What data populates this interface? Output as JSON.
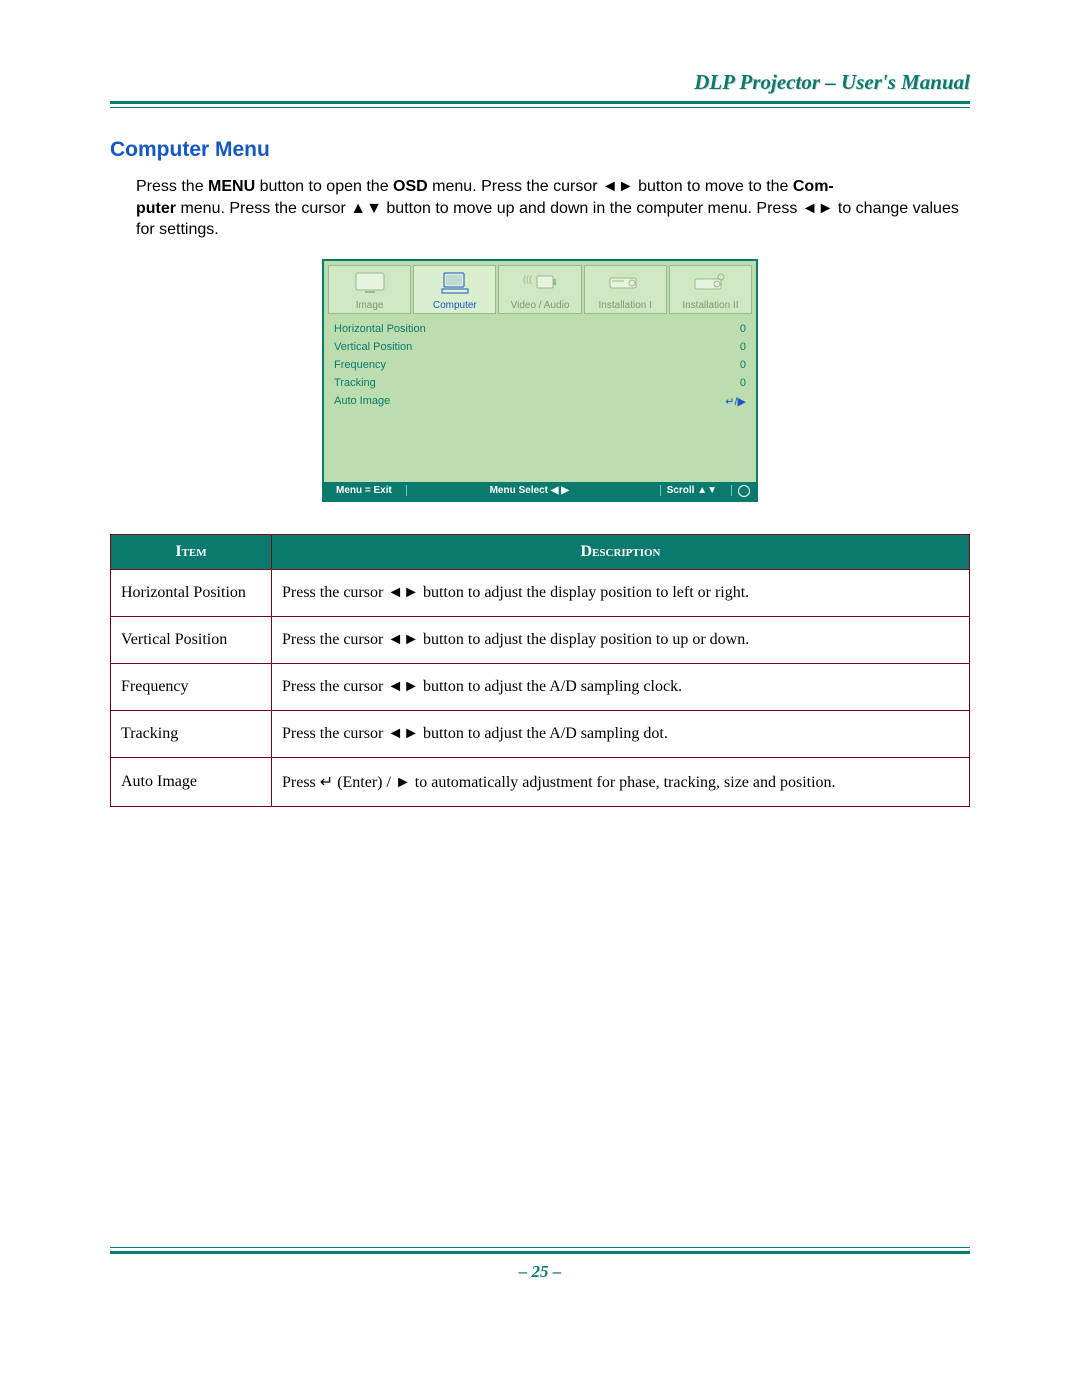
{
  "header": {
    "doc_title": "DLP Projector – User's Manual"
  },
  "section": {
    "heading": "Computer Menu",
    "intro_1": "Press the ",
    "intro_b1": "MENU",
    "intro_2": " button to open the ",
    "intro_b2": "OSD",
    "intro_3": " menu. Press the cursor ◄► button to move to the ",
    "intro_b3": "Com-",
    "intro_b4": "puter",
    "intro_4": " menu. Press the cursor ▲▼ button to move up and down in the computer menu. Press ◄► to change values for settings."
  },
  "osd": {
    "tabs": [
      {
        "label": "Image"
      },
      {
        "label": "Computer"
      },
      {
        "label": "Video / Audio"
      },
      {
        "label": "Installation I"
      },
      {
        "label": "Installation II"
      }
    ],
    "active_tab_index": 1,
    "rows": [
      {
        "label": "Horizontal Position",
        "value": "0"
      },
      {
        "label": "Vertical Position",
        "value": "0"
      },
      {
        "label": "Frequency",
        "value": "0"
      },
      {
        "label": "Tracking",
        "value": "0"
      },
      {
        "label": "Auto Image",
        "value": "↵/▶"
      }
    ],
    "footer": {
      "exit": "Menu = Exit",
      "select": "Menu Select ◀ ▶",
      "scroll": "Scroll ▲▼"
    }
  },
  "table": {
    "headers": {
      "item": "Item",
      "desc": "Description"
    },
    "rows": [
      {
        "item": "Horizontal Position",
        "desc": "Press the cursor ◄► button to adjust the display position to left or right."
      },
      {
        "item": "Vertical Position",
        "desc": "Press the cursor ◄► button to adjust the display position to up or down."
      },
      {
        "item": "Frequency",
        "desc": "Press the cursor ◄► button to adjust the A/D sampling clock."
      },
      {
        "item": "Tracking",
        "desc": "Press the cursor ◄► button to adjust the A/D sampling dot."
      },
      {
        "item": "Auto Image",
        "desc": "Press ↵ (Enter) / ► to automatically adjustment for phase, tracking, size and position."
      }
    ]
  },
  "footer": {
    "page_number": "– 25 –"
  }
}
